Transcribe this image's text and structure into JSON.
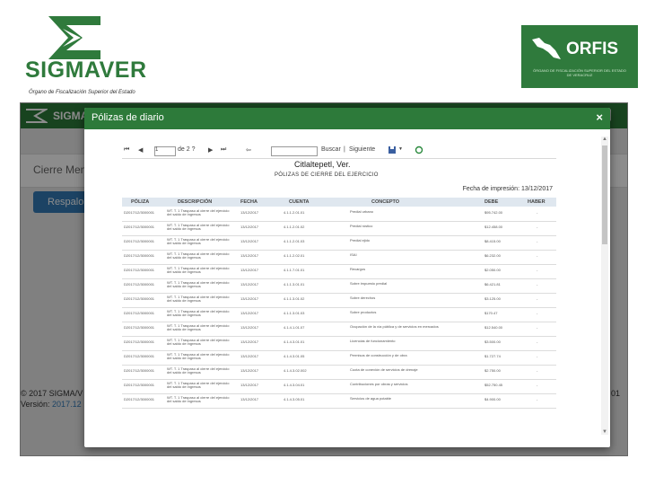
{
  "brand": {
    "name": "SIGMAVER",
    "subtitle": "Órgano de Fiscalización Superior del Estado",
    "orfis_word": "ORFIS",
    "orfis_sub": "ÓRGANO DE FISCALIZACIÓN SUPERIOR DEL ESTADO DE VERACRUZ",
    "green": "#2f7a3c"
  },
  "app": {
    "nav_brand": "SIGMAVER",
    "panel_title": "Cierre Men",
    "button_label": "Respalo",
    "footer_line1": "© 2017   SIGMA/V",
    "footer_version_label": "Versión:",
    "footer_version_value": "2017.12",
    "footer_right": "01"
  },
  "modal": {
    "title": "Pólizas de diario",
    "close_glyph": "×",
    "toolbar": {
      "first": "⏮",
      "prev": "◀",
      "page_value": "1",
      "page_of": "de 2 ?",
      "next": "▶",
      "last": "⏭",
      "back": "⇦",
      "find": "Buscar",
      "sep": "|",
      "next_find": "Siguiente",
      "export_icon": "save-icon",
      "refresh_icon": "refresh-icon"
    },
    "report": {
      "entity": "Citlaltepetl, Ver.",
      "heading": "PÓLIZAS DE CIERRE DEL EJERCICIO",
      "print_date": "Fecha de impresión: 13/12/2017",
      "columns": [
        "PÓLIZA",
        "DESCRIPCIÓN",
        "FECHA",
        "CUENTA",
        "CONCEPTO",
        "DEBE",
        "HABER"
      ],
      "rows": [
        [
          "D2017/12/3000001",
          "WT. T.  1  Traspaso al cierre del ejercicio del saldo de ingresos",
          "13/12/2017",
          "4.1.1.2.01.01",
          "Predial urbano",
          "$95.742.00",
          "-"
        ],
        [
          "D2017/12/3000001",
          "WT. T.  1  Traspaso al cierre del ejercicio del saldo de ingresos",
          "13/12/2017",
          "4.1.1.2.01.02",
          "Predial rústico",
          "$12.458.00",
          "-"
        ],
        [
          "D2017/12/3000001",
          "WT. T.  1  Traspaso al cierre del ejercicio del saldo de ingresos",
          "13/12/2017",
          "4.1.1.2.01.03",
          "Predial ejido",
          "$8.415.00",
          "-"
        ],
        [
          "D2017/12/3000001",
          "WT. T.  1  Traspaso al cierre del ejercicio del saldo de ingresos",
          "13/12/2017",
          "4.1.1.2.02.01",
          "ISAI",
          "$6.232.00",
          "-"
        ],
        [
          "D2017/12/3000001",
          "WT. T.  1  Traspaso al cierre del ejercicio del saldo de ingresos",
          "13/12/2017",
          "4.1.1.7.01.01",
          "Recargos",
          "$2.050.00",
          "-"
        ],
        [
          "D2017/12/3000001",
          "WT. T.  1  Traspaso al cierre del ejercicio del saldo de ingresos",
          "13/12/2017",
          "4.1.1.3.01.01",
          "Sobre impuesto predial",
          "$6.421.81",
          "-"
        ],
        [
          "D2017/12/3000001",
          "WT. T.  1  Traspaso al cierre del ejercicio del saldo de ingresos",
          "13/12/2017",
          "4.1.1.3.01.02",
          "Sobre derechos",
          "$3.125.00",
          "-"
        ],
        [
          "D2017/12/3000001",
          "WT. T.  1  Traspaso al cierre del ejercicio del saldo de ingresos",
          "13/12/2017",
          "4.1.1.3.01.03",
          "Sobre productos",
          "$170.47",
          "-"
        ],
        [
          "D2017/12/3000001",
          "WT. T.  1  Traspaso al cierre del ejercicio del saldo de ingresos",
          "13/12/2017",
          "4.1.4.1.01.07",
          "Ocupación de la vía pública y de servicios en mercados",
          "$12.540.00",
          "-"
        ],
        [
          "D2017/12/3000001",
          "WT. T.  1  Traspaso al cierre del ejercicio del saldo de ingresos",
          "13/12/2017",
          "4.1.4.3.01.01",
          "Licencias de funcionamiento",
          "$3.500.00",
          "-"
        ],
        [
          "D2017/12/3000001",
          "WT. T.  1  Traspaso al cierre del ejercicio del saldo de ingresos",
          "13/12/2017",
          "4.1.4.3.01.05",
          "Permisos de construcción y de obra",
          "$1.727.74",
          "-"
        ],
        [
          "D2017/12/3000001",
          "WT. T.  1  Traspaso al cierre del ejercicio del saldo de ingresos",
          "13/12/2017",
          "4.1.4.3.02.002",
          "Cuota de conexión de servicios de drenaje",
          "$2.750.00",
          "-"
        ],
        [
          "D2017/12/3000001",
          "WT. T.  1  Traspaso al cierre del ejercicio del saldo de ingresos",
          "13/12/2017",
          "4.1.4.3.04.01",
          "Contribuciones por obras y servicios",
          "$52.750.45",
          "-"
        ],
        [
          "D2017/12/3000001",
          "WT. T.  1  Traspaso al cierre del ejercicio del saldo de ingresos",
          "13/12/2017",
          "4.1.4.3.05.01",
          "Servicios de agua potable",
          "$4.900.00",
          "-"
        ]
      ]
    }
  }
}
